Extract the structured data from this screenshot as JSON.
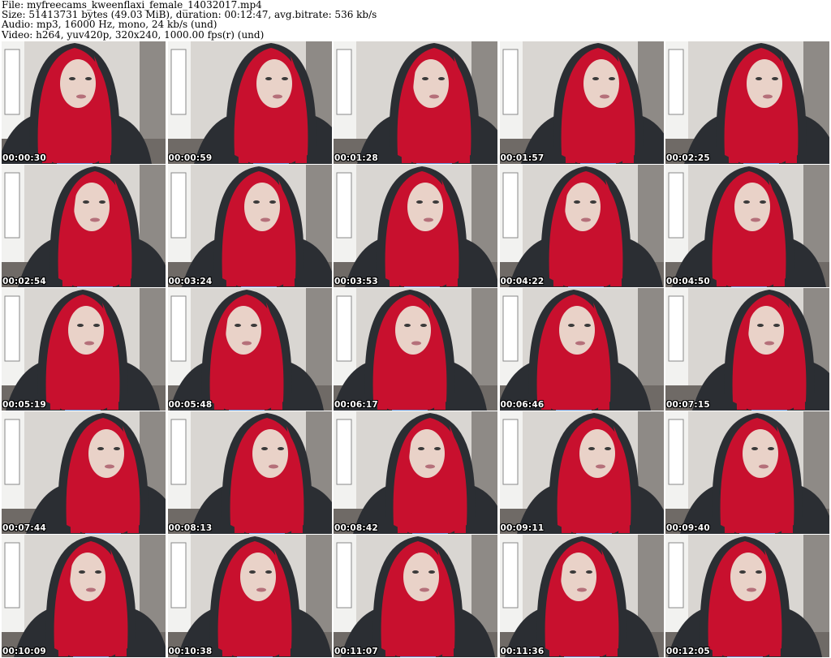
{
  "header": {
    "file_line": "File: myfreecams_kweenflaxi_female_14032017.mp4",
    "size_line": "Size: 51413731 bytes (49.03 MiB), duration: 00:12:47, avg.bitrate: 536 kb/s",
    "audio_line": "Audio: mp3, 16000 Hz, mono, 24 kb/s (und)",
    "video_line": "Video: h264, yuv420p, 320x240, 1000.00 fps(r) (und)"
  },
  "thumbnails": [
    {
      "timestamp": "00:00:30"
    },
    {
      "timestamp": "00:00:59"
    },
    {
      "timestamp": "00:01:28"
    },
    {
      "timestamp": "00:01:57"
    },
    {
      "timestamp": "00:02:25"
    },
    {
      "timestamp": "00:02:54"
    },
    {
      "timestamp": "00:03:24"
    },
    {
      "timestamp": "00:03:53"
    },
    {
      "timestamp": "00:04:22"
    },
    {
      "timestamp": "00:04:50"
    },
    {
      "timestamp": "00:05:19"
    },
    {
      "timestamp": "00:05:48"
    },
    {
      "timestamp": "00:06:17"
    },
    {
      "timestamp": "00:06:46"
    },
    {
      "timestamp": "00:07:15"
    },
    {
      "timestamp": "00:07:44"
    },
    {
      "timestamp": "00:08:13"
    },
    {
      "timestamp": "00:08:42"
    },
    {
      "timestamp": "00:09:11"
    },
    {
      "timestamp": "00:09:40"
    },
    {
      "timestamp": "00:10:09"
    },
    {
      "timestamp": "00:10:38"
    },
    {
      "timestamp": "00:11:07"
    },
    {
      "timestamp": "00:11:36"
    },
    {
      "timestamp": "00:12:05"
    }
  ],
  "colors": {
    "background": "#ffffff",
    "hair": "#c8102e",
    "hoodie": "#2b2e33",
    "shirt": "#5b86c9",
    "skin": "#e9d2c8",
    "wall": "#d9d6d2",
    "timestamp_text": "#ffffff"
  }
}
